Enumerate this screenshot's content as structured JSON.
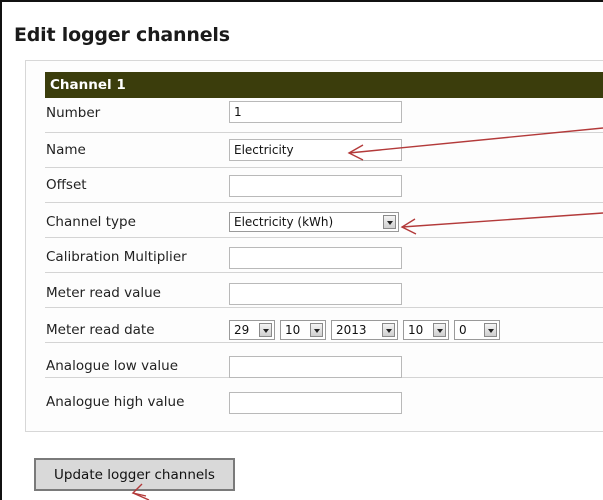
{
  "page_title": "Edit logger channels",
  "channel_header": "Channel 1",
  "fields": {
    "number": {
      "label": "Number",
      "value": "1"
    },
    "name": {
      "label": "Name",
      "value": "Electricity"
    },
    "offset": {
      "label": "Offset",
      "value": ""
    },
    "channel_type": {
      "label": "Channel type",
      "value": "Electricity (kWh)"
    },
    "calibration": {
      "label": "Calibration Multiplier",
      "value": ""
    },
    "meter_value": {
      "label": "Meter read value",
      "value": ""
    },
    "meter_date": {
      "label": "Meter read date",
      "day": "29",
      "month": "10",
      "year": "2013",
      "hour": "10",
      "minute": "0"
    },
    "analogue_low": {
      "label": "Analogue low value",
      "value": ""
    },
    "analogue_high": {
      "label": "Analogue high value",
      "value": ""
    }
  },
  "update_button": "Update logger channels",
  "colors": {
    "header_bg": "#3b3d0c",
    "annotation_arrow": "#b33a3a"
  },
  "icons": [
    "dropdown-arrow-icon",
    "annotation-arrow-icon"
  ]
}
